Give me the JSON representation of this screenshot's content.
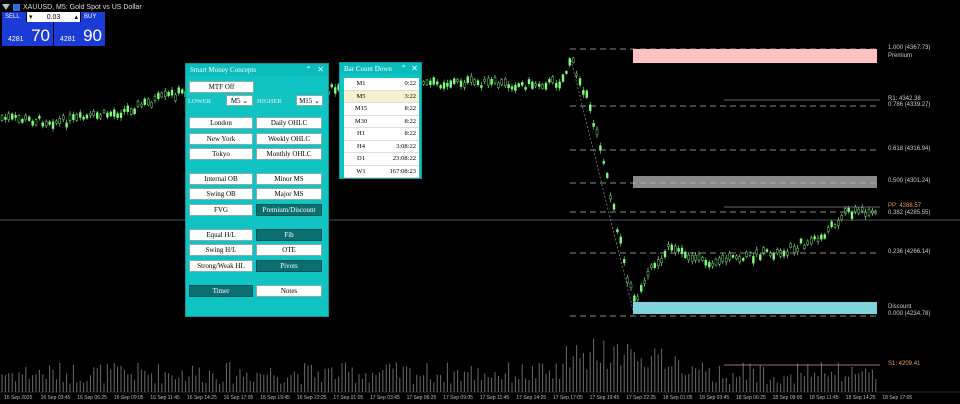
{
  "header": {
    "title": "XAUUSD, M5: Gold Spot vs US Dollar"
  },
  "trading": {
    "sell_label": "SELL",
    "buy_label": "BUY",
    "qty": "0.03",
    "sell_small": "4281",
    "sell_big": "70",
    "buy_small": "4281",
    "buy_big": "90"
  },
  "smc_panel": {
    "title": "Smart Money Concepts",
    "mtf": "MTF Off",
    "lower_label": "LOWER",
    "lower_value": "M5",
    "higher_label": "HIGHER",
    "higher_value": "M15",
    "buttons": {
      "london": "London",
      "daily_ohlc": "Daily OHLC",
      "new_york": "New York",
      "weekly_ohlc": "Weekly OHLC",
      "tokyo": "Tokyo",
      "monthly_ohlc": "Monthly OHLC",
      "internal_ob": "Internal OB",
      "minor_ms": "Minor MS",
      "swing_ob": "Swing OB",
      "major_ms": "Major MS",
      "fvg": "FVG",
      "premium_discount": "Premium/Discount",
      "equal_hl": "Equal H/L",
      "fib": "Fib",
      "swing_hl": "Swing H/L",
      "ote": "OTE",
      "strong_weak_hl": "Strong/Weak HL",
      "pivots": "Pivots",
      "timer": "Timer",
      "notes": "Notes"
    }
  },
  "bar_countdown": {
    "title": "Bar Count Down",
    "rows": [
      {
        "tf": "M1",
        "time": "0:22"
      },
      {
        "tf": "M5",
        "time": "3:22"
      },
      {
        "tf": "M15",
        "time": "8:22"
      },
      {
        "tf": "M30",
        "time": "8:22"
      },
      {
        "tf": "H1",
        "time": "8:22"
      },
      {
        "tf": "H4",
        "time": "3:08:22"
      },
      {
        "tf": "D1",
        "time": "23:08:22"
      },
      {
        "tf": "W1",
        "time": "167:08:23"
      }
    ]
  },
  "levels": {
    "fib_1000": "1.000 (4367.73)",
    "premium": "Premium",
    "r1": "R1: 4342.38",
    "fib_786": "0.786 (4339.27)",
    "fib_618": "0.618 (4316.94)",
    "fib_500": "0.500 (4301.24)",
    "pp": "PP: 4288.57",
    "fib_382": "0.382 (4285.55)",
    "fib_236": "0.236 (4266.14)",
    "discount": "Discount",
    "fib_000": "0.000 (4234.78)",
    "s1": "S1: 4209.41"
  },
  "time_axis": [
    "16 Sep 2025",
    "16 Sep 03:45",
    "16 Sep 06:25",
    "16 Sep 09:05",
    "16 Sep 11:45",
    "16 Sep 14:25",
    "16 Sep 17:05",
    "16 Sep 19:45",
    "16 Sep 22:25",
    "17 Sep 01:05",
    "17 Sep 03:45",
    "17 Sep 06:25",
    "17 Sep 09:05",
    "17 Sep 11:45",
    "17 Sep 14:25",
    "17 Sep 17:05",
    "17 Sep 19:45",
    "17 Sep 22:25",
    "18 Sep 01:05",
    "18 Sep 03:45",
    "18 Sep 06:25",
    "18 Sep 09:05",
    "18 Sep 11:45",
    "18 Sep 14:25",
    "18 Sep 17:05"
  ],
  "colors": {
    "panel": "#10c4c4",
    "button_on": "#0b6f6f",
    "candle_up": "#7cff7c",
    "candle_down": "#c8ffc8",
    "premium_zone": "#ffc1c1",
    "discount_zone": "#7fd3dc",
    "equilibrium_zone": "#8a8a8a",
    "trade_blue": "#1b3bd6",
    "pp_label": "#e0a36e",
    "s1_label": "#e0a36e"
  }
}
